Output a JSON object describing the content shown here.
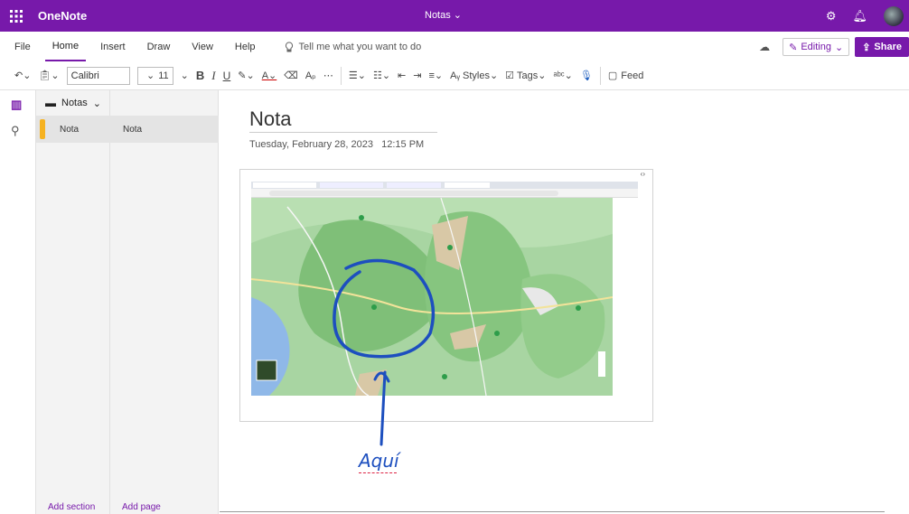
{
  "titlebar": {
    "app_name": "OneNote",
    "notebook": "Notas ⌄",
    "bg": "#7719aa"
  },
  "menu": {
    "items": [
      "File",
      "Home",
      "Insert",
      "Draw",
      "View",
      "Help"
    ],
    "active": "Home",
    "tellme_placeholder": "Tell me what you want to do",
    "editing_label": "Editing",
    "share_label": "Share"
  },
  "toolbar": {
    "font": "Calibri",
    "size": "11",
    "styles_label": "Styles",
    "tags_label": "Tags",
    "feed_label": "Feed"
  },
  "navigation": {
    "notebook_name": "Notas",
    "section_name": "Nota",
    "page_name": "Nota",
    "add_section": "Add section",
    "add_page": "Add page"
  },
  "page": {
    "title": "Nota",
    "date": "Tuesday, February 28, 2023",
    "time": "12:15 PM",
    "annotation": "Aquí",
    "ink_color": "#1d4fbf"
  },
  "icons": [
    "waffle-icon",
    "settings-icon",
    "bell-icon",
    "undo-icon",
    "clipboard-icon",
    "lightbulb-icon",
    "notebooks-icon",
    "search-icon",
    "mic-icon"
  ]
}
